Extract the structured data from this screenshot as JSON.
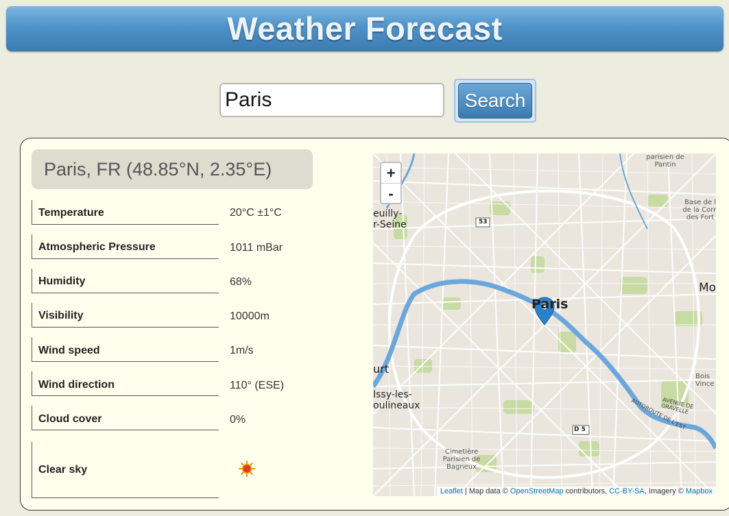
{
  "header": {
    "title": "Weather Forecast"
  },
  "search": {
    "value": "Paris",
    "button_label": "Search"
  },
  "location": {
    "title": "Paris, FR (48.85°N, 2.35°E)"
  },
  "weather": {
    "rows": [
      {
        "label": "Temperature",
        "value": "20°C ±1°C"
      },
      {
        "label": "Atmospheric Pressure",
        "value": "1011 mBar"
      },
      {
        "label": "Humidity",
        "value": "68%"
      },
      {
        "label": "Visibility",
        "value": "10000m"
      },
      {
        "label": "Wind speed",
        "value": "1m/s"
      },
      {
        "label": "Wind direction",
        "value": "110° (ESE)"
      },
      {
        "label": "Cloud cover",
        "value": "0%"
      }
    ],
    "condition": {
      "label": "Clear sky",
      "icon": "sun-icon"
    }
  },
  "map": {
    "zoom_in": "+",
    "zoom_out": "-",
    "labels": {
      "paris": "Paris",
      "pantin": "parisien de Pantin",
      "neuilly": "euilly- r-Seine",
      "base": "Base de l de la Corn des Fort",
      "mo": "Mo",
      "urt": "urt",
      "issy": "Issy-les- oulineaux",
      "bois": "Bois Vince",
      "avenue": "AVENUE DE GRAVELLE",
      "autoroute": "AUTOROUTE DE L'EST",
      "cimetiere": "Cimetière Parisien de Bagneux",
      "d5": "D 5",
      "s53": "53"
    },
    "attribution": {
      "leaflet": "Leaflet",
      "sep1": " | Map data © ",
      "osm": "OpenStreetMap",
      "contrib": " contributors, ",
      "ccbysa": "CC-BY-SA",
      "imagery": ", Imagery © ",
      "mapbox": "Mapbox"
    },
    "colors": {
      "river": "#6aa7dc",
      "park": "#c8dca5",
      "road": "#ffffff",
      "marker": "#2a81cb"
    }
  }
}
